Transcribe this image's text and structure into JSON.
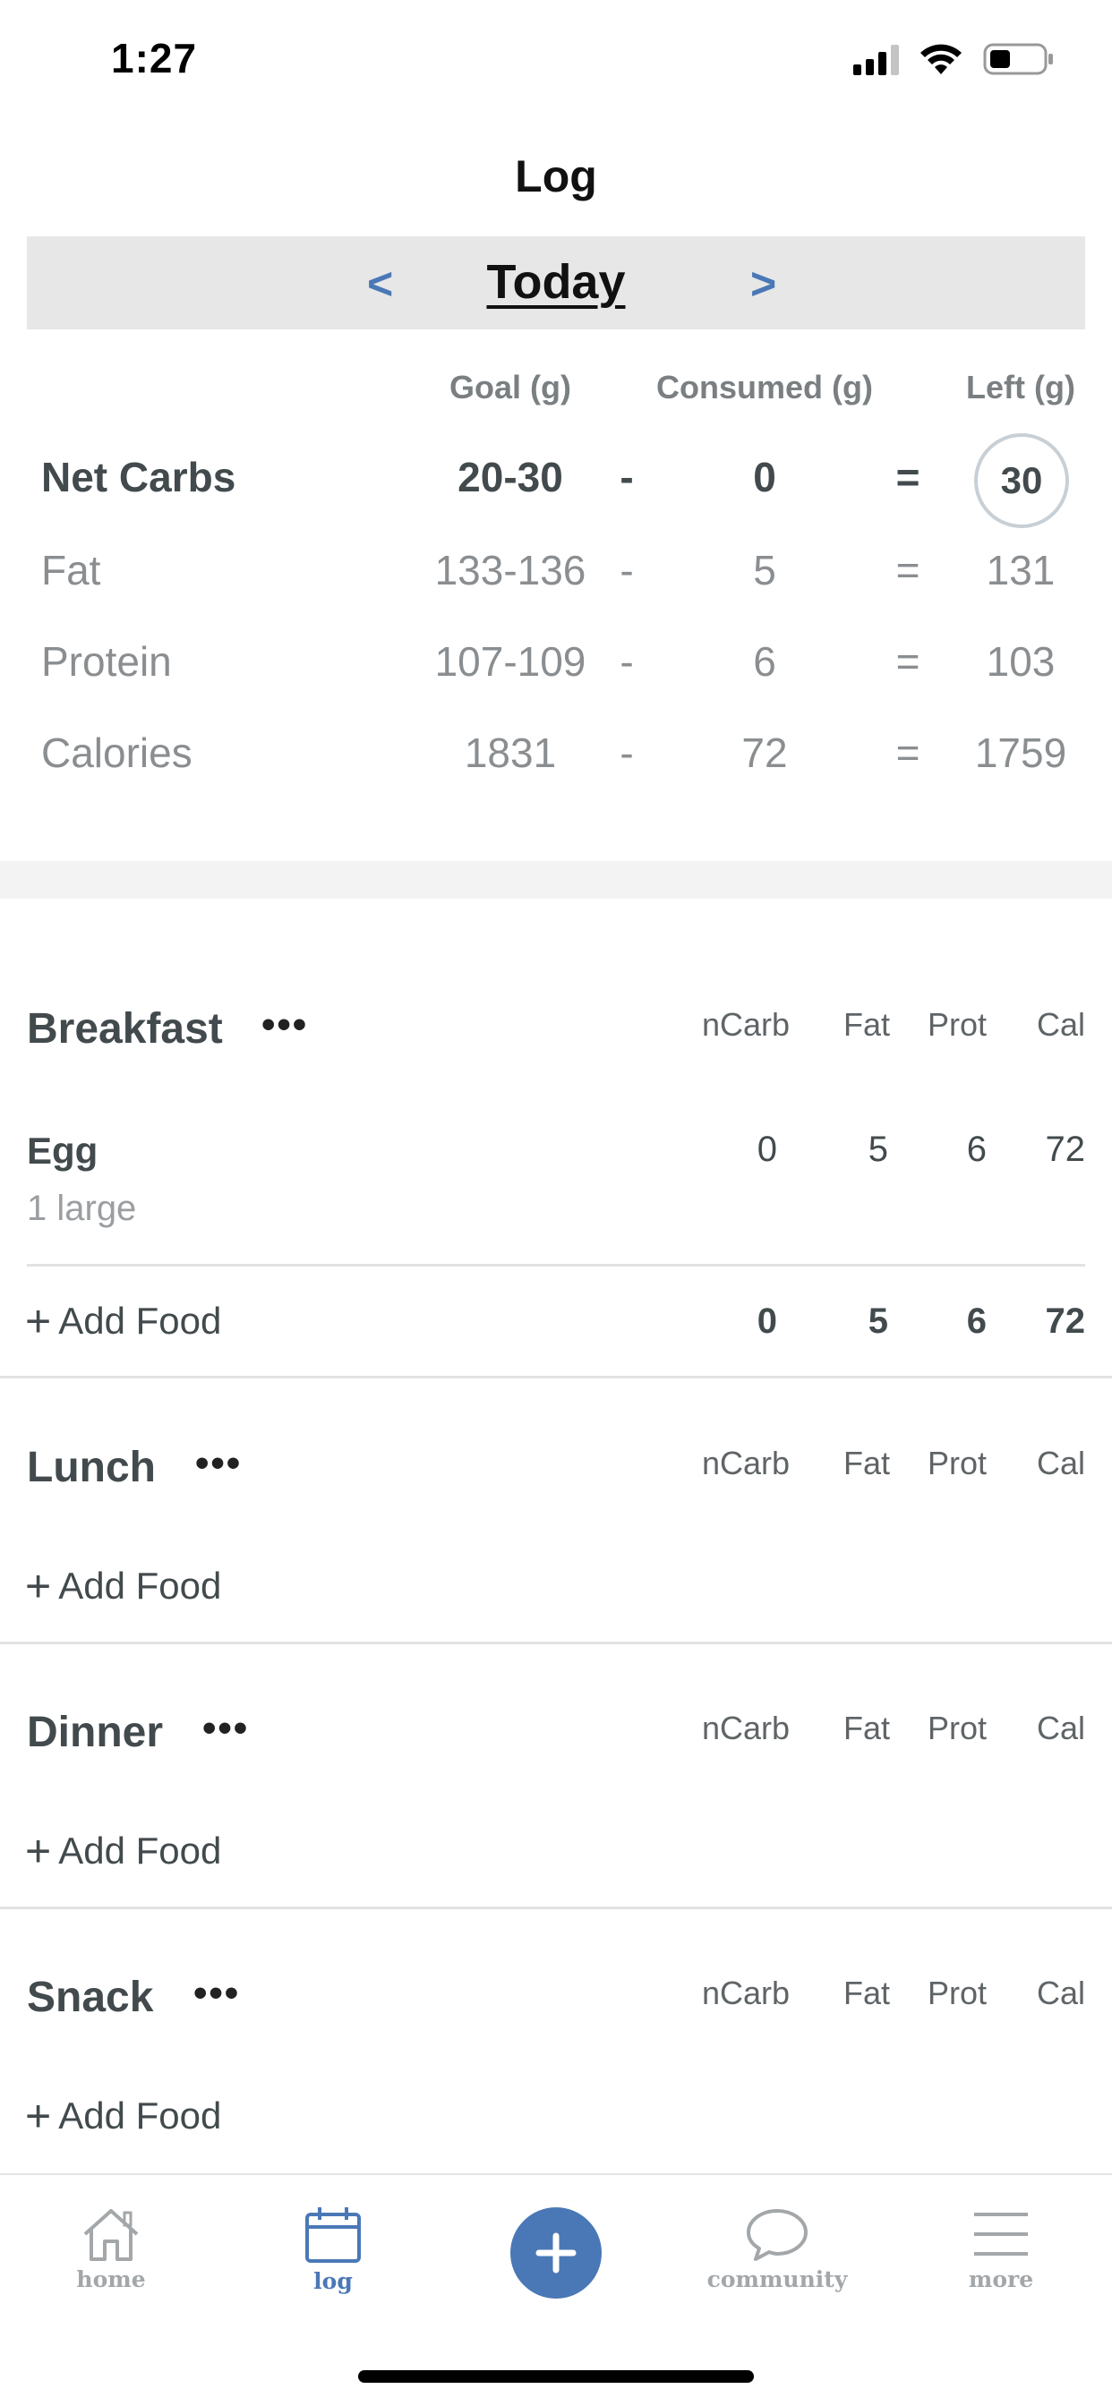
{
  "status_bar": {
    "time": "1:27"
  },
  "header": {
    "title": "Log",
    "date_label": "Today",
    "prev": "<",
    "next": ">"
  },
  "macros": {
    "headers": {
      "goal": "Goal (g)",
      "consumed": "Consumed (g)",
      "left": "Left (g)"
    },
    "rows": [
      {
        "name": "Net Carbs",
        "goal": "20-30",
        "minus": "-",
        "consumed": "0",
        "equals": "=",
        "left": "30"
      },
      {
        "name": "Fat",
        "goal": "133-136",
        "minus": "-",
        "consumed": "5",
        "equals": "=",
        "left": "131"
      },
      {
        "name": "Protein",
        "goal": "107-109",
        "minus": "-",
        "consumed": "6",
        "equals": "=",
        "left": "103"
      },
      {
        "name": "Calories",
        "goal": "1831",
        "minus": "-",
        "consumed": "72",
        "equals": "=",
        "left": "1759"
      }
    ]
  },
  "meal_columns": {
    "ncarb": "nCarb",
    "fat": "Fat",
    "prot": "Prot",
    "cal": "Cal"
  },
  "meals": [
    {
      "name": "Breakfast",
      "menu": "•••",
      "add_food": "Add Food",
      "foods": [
        {
          "name": "Egg",
          "serving": "1 large",
          "ncarb": "0",
          "fat": "5",
          "prot": "6",
          "cal": "72"
        }
      ],
      "totals": {
        "ncarb": "0",
        "fat": "5",
        "prot": "6",
        "cal": "72"
      }
    },
    {
      "name": "Lunch",
      "menu": "•••",
      "add_food": "Add Food"
    },
    {
      "name": "Dinner",
      "menu": "•••",
      "add_food": "Add Food"
    },
    {
      "name": "Snack",
      "menu": "•••",
      "add_food": "Add Food"
    }
  ],
  "tab_bar": {
    "items": [
      {
        "label": "home",
        "icon": "home-icon"
      },
      {
        "label": "log",
        "icon": "calendar-icon",
        "active": true
      },
      {
        "label": "",
        "icon": "plus-icon"
      },
      {
        "label": "community",
        "icon": "chat-bubble-icon"
      },
      {
        "label": "more",
        "icon": "menu-icon"
      }
    ]
  },
  "colors": {
    "accent": "#4a78b6",
    "text": "#424a4d",
    "muted": "#8a8e91",
    "date_bar": "#e7e7e7"
  }
}
